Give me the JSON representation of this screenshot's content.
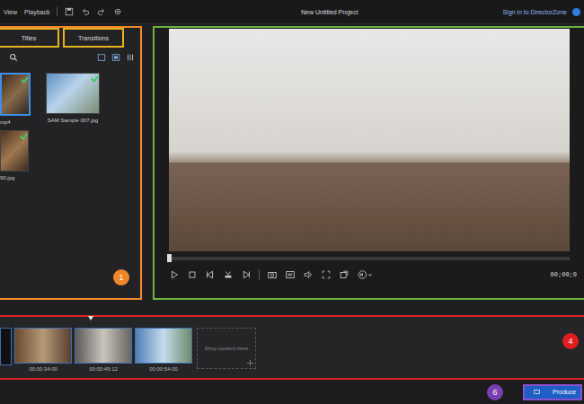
{
  "window": {
    "title": "New Untitled Project"
  },
  "menu": [
    {
      "label": "View"
    },
    {
      "label": "Playback"
    }
  ],
  "account": {
    "label": "Sign in to DirectorZone"
  },
  "library": {
    "badge": "1",
    "tabs": [
      {
        "label": "Titles",
        "selected": false
      },
      {
        "label": "Transitions",
        "selected": false
      }
    ],
    "items": [
      {
        "name": "mp4",
        "used": true,
        "selected": true
      },
      {
        "name": "SAM Sample 007.jpg",
        "used": true,
        "selected": false
      },
      {
        "name": "90.jpg",
        "used": true,
        "selected": false
      }
    ]
  },
  "preview": {
    "time": "00;00;0",
    "level": 0
  },
  "timeline": {
    "badge": "4",
    "clips": [
      {
        "duration": "00:00:34:00"
      },
      {
        "duration": "00:00:45:12"
      },
      {
        "duration": "00:00:54:00"
      }
    ],
    "drop_hint": "Drop content here"
  },
  "footer": {
    "badge": "6",
    "produce": "Produce"
  }
}
